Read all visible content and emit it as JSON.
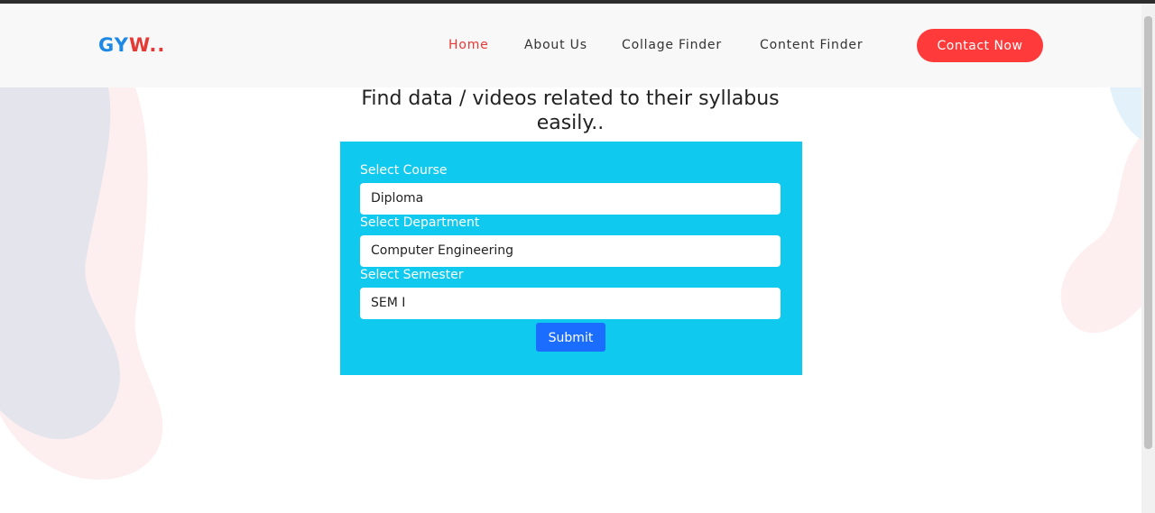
{
  "header": {
    "logo_part1": "GY",
    "logo_part2": "W..",
    "nav": {
      "home": "Home",
      "about": "About Us",
      "collage_finder": "Collage Finder",
      "content_finder": "Content Finder"
    },
    "contact_button": "Contact Now"
  },
  "main": {
    "headline": "Find data / videos related to their syllabus easily..",
    "form": {
      "course_label": "Select Course",
      "course_value": "Diploma",
      "department_label": "Select Department",
      "department_value": "Computer Engineering",
      "semester_label": "Select Semester",
      "semester_value": "SEM I",
      "submit_label": "Submit"
    }
  },
  "colors": {
    "accent": "#ff3a3a",
    "panel": "#10c9ee",
    "submit": "#1a6dff",
    "logo_blue": "#1e88e5",
    "logo_red": "#e53935"
  }
}
